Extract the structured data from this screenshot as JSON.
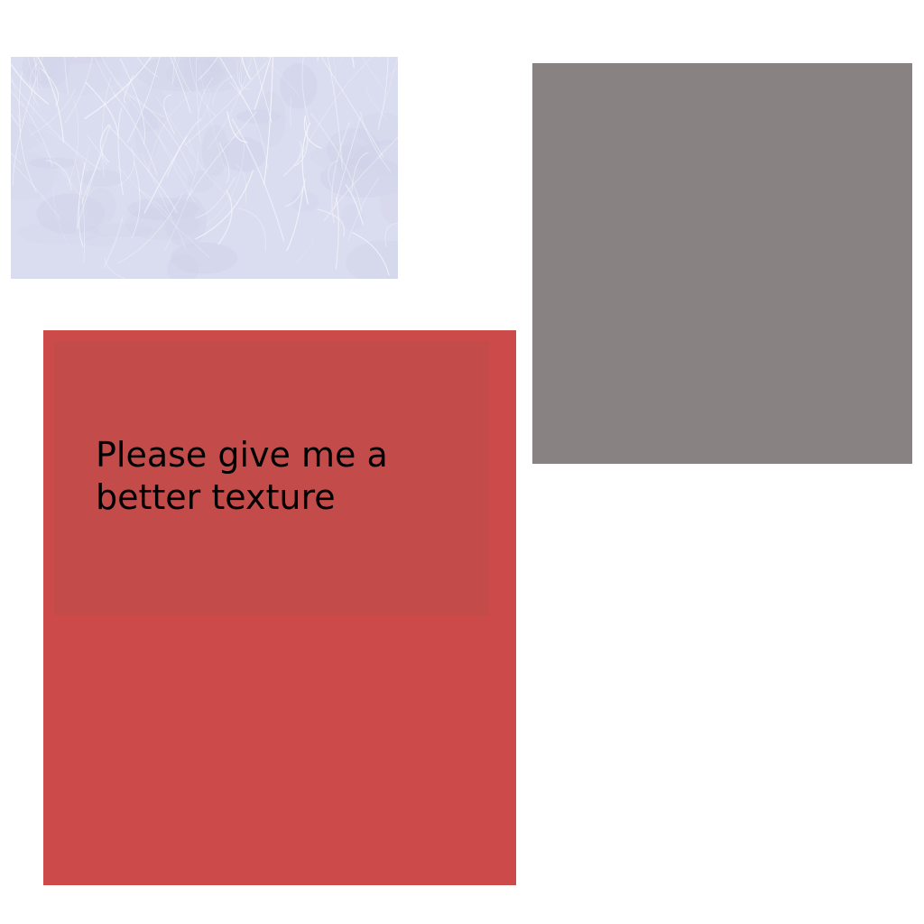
{
  "background_color": "#ffffff",
  "texture_panel": {
    "base_color": "#dadcef",
    "scratch_color": "#ffffff",
    "shade_color": "#c6c9e3"
  },
  "gray_panel": {
    "color": "#888282"
  },
  "red_panel": {
    "color": "#cd4a4a",
    "inner_color": "#c34c4b",
    "text_color": "#000000",
    "message": "Please give me a\nbetter texture"
  }
}
